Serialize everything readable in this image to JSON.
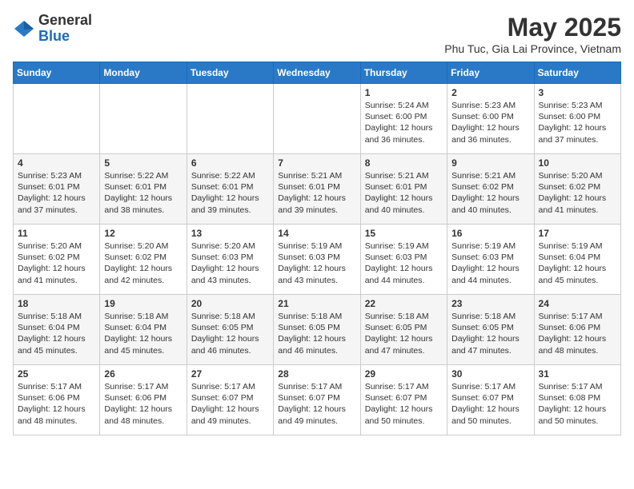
{
  "header": {
    "logo_line1": "General",
    "logo_line2": "Blue",
    "month_year": "May 2025",
    "location": "Phu Tuc, Gia Lai Province, Vietnam"
  },
  "days_of_week": [
    "Sunday",
    "Monday",
    "Tuesday",
    "Wednesday",
    "Thursday",
    "Friday",
    "Saturday"
  ],
  "weeks": [
    [
      {
        "day": "",
        "info": ""
      },
      {
        "day": "",
        "info": ""
      },
      {
        "day": "",
        "info": ""
      },
      {
        "day": "",
        "info": ""
      },
      {
        "day": "1",
        "info": "Sunrise: 5:24 AM\nSunset: 6:00 PM\nDaylight: 12 hours\nand 36 minutes."
      },
      {
        "day": "2",
        "info": "Sunrise: 5:23 AM\nSunset: 6:00 PM\nDaylight: 12 hours\nand 36 minutes."
      },
      {
        "day": "3",
        "info": "Sunrise: 5:23 AM\nSunset: 6:00 PM\nDaylight: 12 hours\nand 37 minutes."
      }
    ],
    [
      {
        "day": "4",
        "info": "Sunrise: 5:23 AM\nSunset: 6:01 PM\nDaylight: 12 hours\nand 37 minutes."
      },
      {
        "day": "5",
        "info": "Sunrise: 5:22 AM\nSunset: 6:01 PM\nDaylight: 12 hours\nand 38 minutes."
      },
      {
        "day": "6",
        "info": "Sunrise: 5:22 AM\nSunset: 6:01 PM\nDaylight: 12 hours\nand 39 minutes."
      },
      {
        "day": "7",
        "info": "Sunrise: 5:21 AM\nSunset: 6:01 PM\nDaylight: 12 hours\nand 39 minutes."
      },
      {
        "day": "8",
        "info": "Sunrise: 5:21 AM\nSunset: 6:01 PM\nDaylight: 12 hours\nand 40 minutes."
      },
      {
        "day": "9",
        "info": "Sunrise: 5:21 AM\nSunset: 6:02 PM\nDaylight: 12 hours\nand 40 minutes."
      },
      {
        "day": "10",
        "info": "Sunrise: 5:20 AM\nSunset: 6:02 PM\nDaylight: 12 hours\nand 41 minutes."
      }
    ],
    [
      {
        "day": "11",
        "info": "Sunrise: 5:20 AM\nSunset: 6:02 PM\nDaylight: 12 hours\nand 41 minutes."
      },
      {
        "day": "12",
        "info": "Sunrise: 5:20 AM\nSunset: 6:02 PM\nDaylight: 12 hours\nand 42 minutes."
      },
      {
        "day": "13",
        "info": "Sunrise: 5:20 AM\nSunset: 6:03 PM\nDaylight: 12 hours\nand 43 minutes."
      },
      {
        "day": "14",
        "info": "Sunrise: 5:19 AM\nSunset: 6:03 PM\nDaylight: 12 hours\nand 43 minutes."
      },
      {
        "day": "15",
        "info": "Sunrise: 5:19 AM\nSunset: 6:03 PM\nDaylight: 12 hours\nand 44 minutes."
      },
      {
        "day": "16",
        "info": "Sunrise: 5:19 AM\nSunset: 6:03 PM\nDaylight: 12 hours\nand 44 minutes."
      },
      {
        "day": "17",
        "info": "Sunrise: 5:19 AM\nSunset: 6:04 PM\nDaylight: 12 hours\nand 45 minutes."
      }
    ],
    [
      {
        "day": "18",
        "info": "Sunrise: 5:18 AM\nSunset: 6:04 PM\nDaylight: 12 hours\nand 45 minutes."
      },
      {
        "day": "19",
        "info": "Sunrise: 5:18 AM\nSunset: 6:04 PM\nDaylight: 12 hours\nand 45 minutes."
      },
      {
        "day": "20",
        "info": "Sunrise: 5:18 AM\nSunset: 6:05 PM\nDaylight: 12 hours\nand 46 minutes."
      },
      {
        "day": "21",
        "info": "Sunrise: 5:18 AM\nSunset: 6:05 PM\nDaylight: 12 hours\nand 46 minutes."
      },
      {
        "day": "22",
        "info": "Sunrise: 5:18 AM\nSunset: 6:05 PM\nDaylight: 12 hours\nand 47 minutes."
      },
      {
        "day": "23",
        "info": "Sunrise: 5:18 AM\nSunset: 6:05 PM\nDaylight: 12 hours\nand 47 minutes."
      },
      {
        "day": "24",
        "info": "Sunrise: 5:17 AM\nSunset: 6:06 PM\nDaylight: 12 hours\nand 48 minutes."
      }
    ],
    [
      {
        "day": "25",
        "info": "Sunrise: 5:17 AM\nSunset: 6:06 PM\nDaylight: 12 hours\nand 48 minutes."
      },
      {
        "day": "26",
        "info": "Sunrise: 5:17 AM\nSunset: 6:06 PM\nDaylight: 12 hours\nand 48 minutes."
      },
      {
        "day": "27",
        "info": "Sunrise: 5:17 AM\nSunset: 6:07 PM\nDaylight: 12 hours\nand 49 minutes."
      },
      {
        "day": "28",
        "info": "Sunrise: 5:17 AM\nSunset: 6:07 PM\nDaylight: 12 hours\nand 49 minutes."
      },
      {
        "day": "29",
        "info": "Sunrise: 5:17 AM\nSunset: 6:07 PM\nDaylight: 12 hours\nand 50 minutes."
      },
      {
        "day": "30",
        "info": "Sunrise: 5:17 AM\nSunset: 6:07 PM\nDaylight: 12 hours\nand 50 minutes."
      },
      {
        "day": "31",
        "info": "Sunrise: 5:17 AM\nSunset: 6:08 PM\nDaylight: 12 hours\nand 50 minutes."
      }
    ]
  ]
}
